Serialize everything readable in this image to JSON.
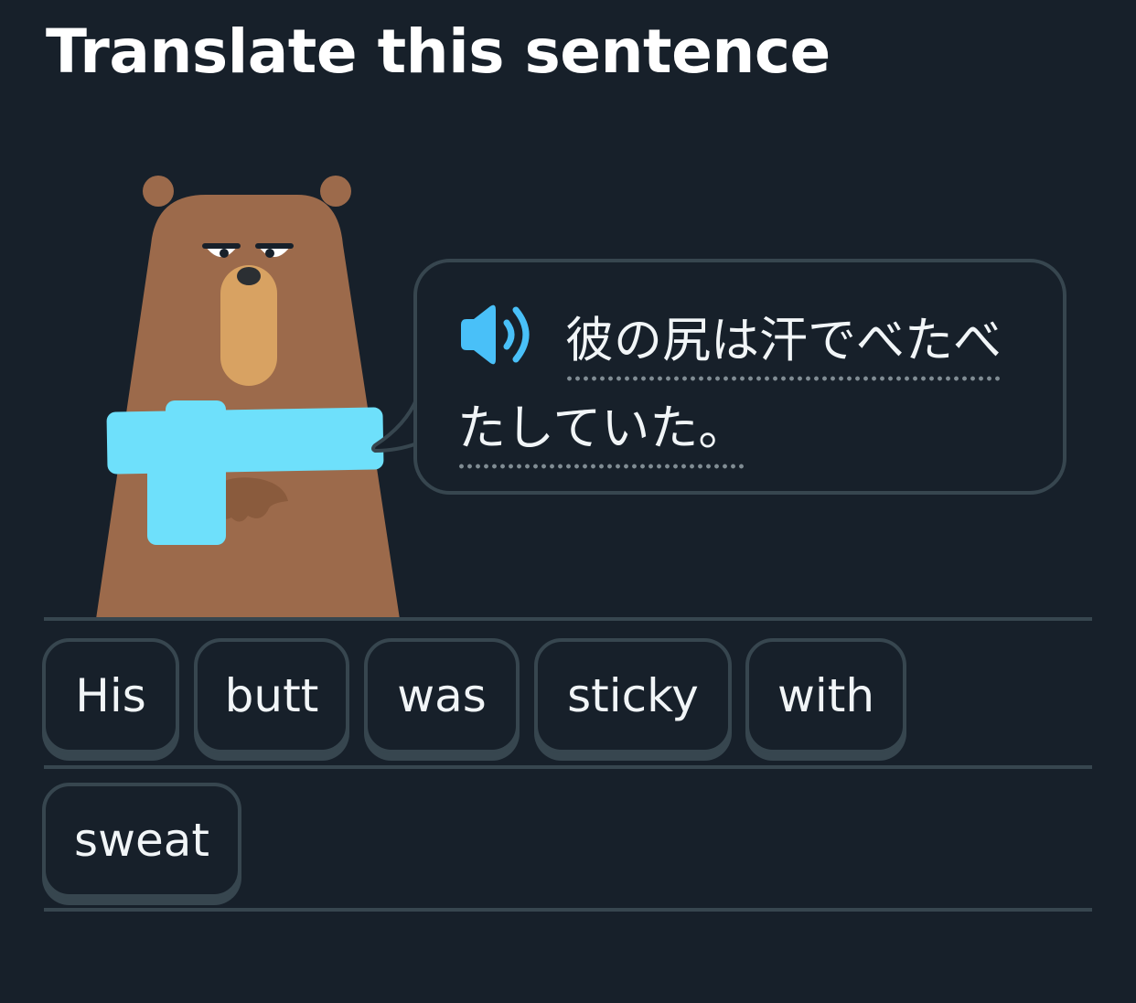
{
  "header": {
    "title": "Translate this sentence"
  },
  "prompt": {
    "speaker_icon": "speaker-icon",
    "sentence": "彼の尻は汗でべたべたしていた。"
  },
  "word_bank": {
    "rows": [
      [
        "His",
        "butt",
        "was",
        "sticky",
        "with"
      ],
      [
        "sweat"
      ]
    ]
  },
  "colors": {
    "background": "#17202a",
    "border": "#37464f",
    "text": "#f1f5f7",
    "accent_blue": "#49c0f8",
    "bear_fur": "#9c6a4b",
    "scarf": "#6ee0fb"
  }
}
